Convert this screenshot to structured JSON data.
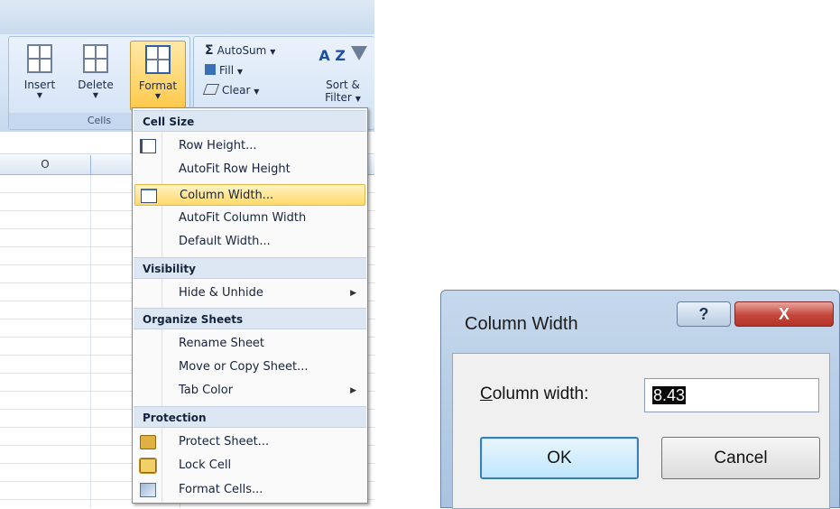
{
  "ribbon": {
    "insert_label": "Insert",
    "delete_label": "Delete",
    "format_label": "Format",
    "cells_group_label": "Cells",
    "autosum_label": "AutoSum",
    "fill_label": "Fill",
    "clear_label": "Clear",
    "sort_label": "Sort &",
    "filter_label": "Filter",
    "dropdown_arrow": "▼",
    "sigma": "Σ",
    "az_glyph": "A Z"
  },
  "sheet": {
    "column_header": "O"
  },
  "menu": {
    "sections": {
      "cell_size": "Cell Size",
      "visibility": "Visibility",
      "organize_sheets": "Organize Sheets",
      "protection": "Protection"
    },
    "items": {
      "row_height": "Row Height...",
      "autofit_row_height": "AutoFit Row Height",
      "column_width": "Column Width...",
      "autofit_column_width": "AutoFit Column Width",
      "default_width": "Default Width...",
      "hide_unhide": "Hide & Unhide",
      "rename_sheet": "Rename Sheet",
      "move_copy_sheet": "Move or Copy Sheet...",
      "tab_color": "Tab Color",
      "protect_sheet": "Protect Sheet...",
      "lock_cell": "Lock Cell",
      "format_cells": "Format Cells..."
    },
    "submenu_arrow": "▶",
    "highlighted_item": "column_width"
  },
  "dialog": {
    "title": "Column Width",
    "help_glyph": "?",
    "close_glyph": "X",
    "field_label_hotkey": "C",
    "field_label_rest": "olumn width:",
    "field_value": "8.43",
    "ok_label": "OK",
    "cancel_label": "Cancel"
  },
  "colors": {
    "highlight": "#ffd96a",
    "close_button": "#c4463a",
    "ok_focus": "#3c7fb1"
  }
}
